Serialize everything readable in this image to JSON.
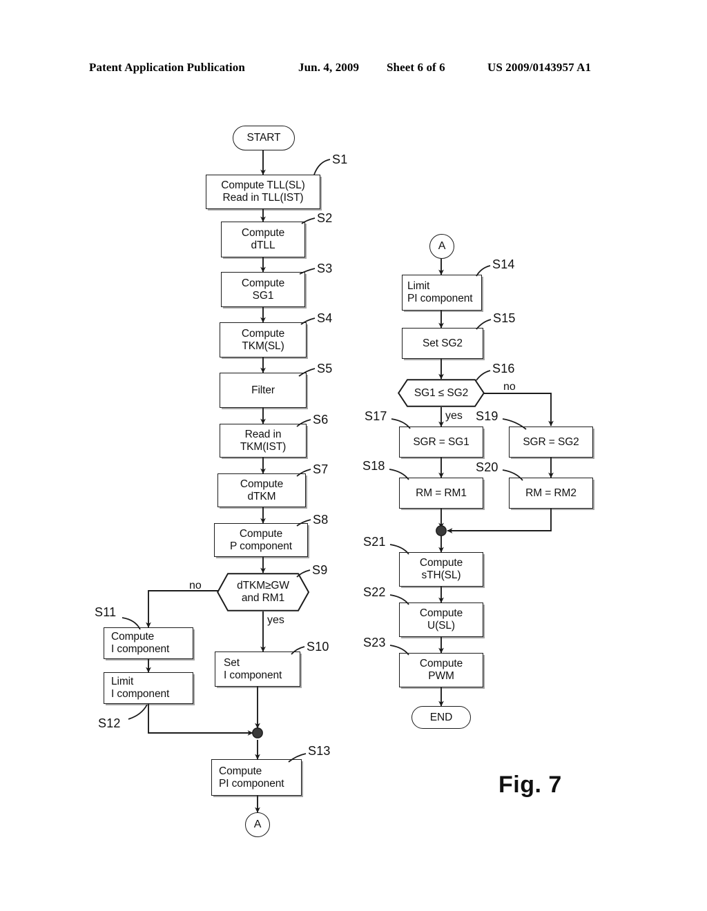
{
  "header": {
    "publication": "Patent Application Publication",
    "date": "Jun. 4, 2009",
    "sheet": "Sheet 6 of 6",
    "patent_number": "US 2009/0143957 A1"
  },
  "figure": {
    "caption": "Fig. 7",
    "type": "flowchart"
  },
  "nodes": {
    "start": {
      "label": "START",
      "shape": "terminator"
    },
    "s1": {
      "step": "S1",
      "line1": "Compute TLL(SL)",
      "line2": "Read in TLL(IST)",
      "shape": "process"
    },
    "s2": {
      "step": "S2",
      "line1": "Compute",
      "line2": "dTLL",
      "shape": "process"
    },
    "s3": {
      "step": "S3",
      "line1": "Compute",
      "line2": "SG1",
      "shape": "process"
    },
    "s4": {
      "step": "S4",
      "line1": "Compute",
      "line2": "TKM(SL)",
      "shape": "process"
    },
    "s5": {
      "step": "S5",
      "line1": "Filter",
      "line2": "",
      "shape": "process"
    },
    "s6": {
      "step": "S6",
      "line1": "Read in",
      "line2": "TKM(IST)",
      "shape": "process"
    },
    "s7": {
      "step": "S7",
      "line1": "Compute",
      "line2": "dTKM",
      "shape": "process"
    },
    "s8": {
      "step": "S8",
      "line1": "Compute",
      "line2": "P component",
      "shape": "process"
    },
    "s9": {
      "step": "S9",
      "line1": "dTKM≥GW",
      "line2": "and RM1",
      "shape": "decision",
      "yes_label": "yes",
      "no_label": "no"
    },
    "s10": {
      "step": "S10",
      "line1": "Set",
      "line2": "I component",
      "shape": "process"
    },
    "s11": {
      "step": "S11",
      "line1": "Compute",
      "line2": "I component",
      "shape": "process"
    },
    "s12": {
      "step": "S12",
      "line1": "Limit",
      "line2": "I component",
      "shape": "process"
    },
    "s13": {
      "step": "S13",
      "line1": "Compute",
      "line2": "PI component",
      "shape": "process"
    },
    "connector_a_out": {
      "label": "A",
      "shape": "connector"
    },
    "connector_a_in": {
      "label": "A",
      "shape": "connector"
    },
    "s14": {
      "step": "S14",
      "line1": "Limit",
      "line2": "PI component",
      "shape": "process"
    },
    "s15": {
      "step": "S15",
      "line1": "Set   SG2",
      "line2": "",
      "shape": "process"
    },
    "s16": {
      "step": "S16",
      "line1": "SG1 ≤ SG2",
      "line2": "",
      "shape": "decision",
      "yes_label": "yes",
      "no_label": "no"
    },
    "s17": {
      "step": "S17",
      "line1": "SGR = SG1",
      "line2": "",
      "shape": "process"
    },
    "s18": {
      "step": "S18",
      "line1": "RM = RM1",
      "line2": "",
      "shape": "process"
    },
    "s19": {
      "step": "S19",
      "line1": "SGR = SG2",
      "line2": "",
      "shape": "process"
    },
    "s20": {
      "step": "S20",
      "line1": "RM = RM2",
      "line2": "",
      "shape": "process"
    },
    "s21": {
      "step": "S21",
      "line1": "Compute",
      "line2": "sTH(SL)",
      "shape": "process"
    },
    "s22": {
      "step": "S22",
      "line1": "Compute",
      "line2": "U(SL)",
      "shape": "process"
    },
    "s23": {
      "step": "S23",
      "line1": "Compute",
      "line2": "PWM",
      "shape": "process"
    },
    "end": {
      "label": "END",
      "shape": "terminator"
    }
  },
  "colors": {
    "ink": "#1b1b1b",
    "paper": "#ffffff"
  }
}
